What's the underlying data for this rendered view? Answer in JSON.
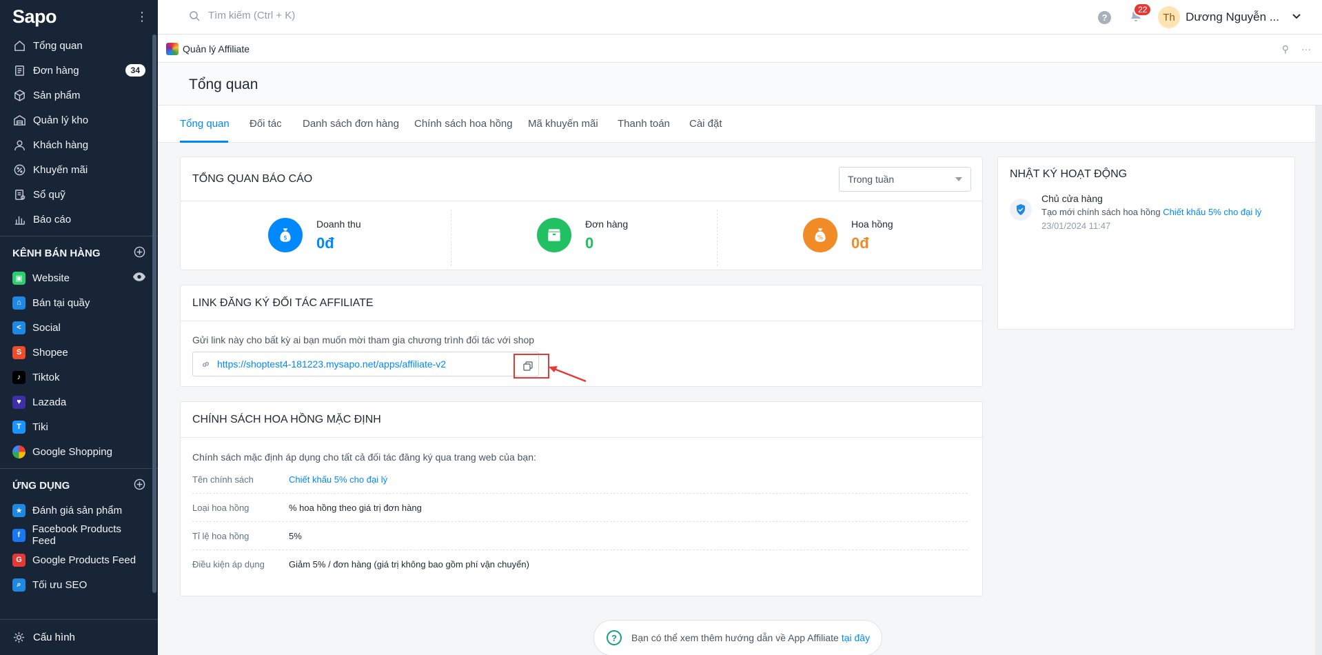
{
  "sidebar": {
    "logo": "Sapo",
    "main_items": [
      {
        "label": "Tổng quan",
        "icon": "home-icon"
      },
      {
        "label": "Đơn hàng",
        "icon": "order-icon",
        "badge": "34"
      },
      {
        "label": "Sản phẩm",
        "icon": "box-icon"
      },
      {
        "label": "Quản lý kho",
        "icon": "warehouse-icon"
      },
      {
        "label": "Khách hàng",
        "icon": "user-icon"
      },
      {
        "label": "Khuyến mãi",
        "icon": "discount-icon"
      },
      {
        "label": "Sổ quỹ",
        "icon": "ledger-icon"
      },
      {
        "label": "Báo cáo",
        "icon": "chart-icon"
      }
    ],
    "channels_title": "KÊNH BÁN HÀNG",
    "channels": [
      {
        "label": "Website",
        "color": "#2ecc71"
      },
      {
        "label": "Bán tại quầy",
        "color": "#1e88e5"
      },
      {
        "label": "Social",
        "color": "#1e88e5"
      },
      {
        "label": "Shopee",
        "color": "#ee4d2d"
      },
      {
        "label": "Tiktok",
        "color": "#000000"
      },
      {
        "label": "Lazada",
        "color": "#3d2fa8"
      },
      {
        "label": "Tiki",
        "color": "#1a94ff"
      },
      {
        "label": "Google Shopping",
        "color": "#ffffff"
      }
    ],
    "apps_title": "ỨNG DỤNG",
    "apps": [
      {
        "label": "Đánh giá sản phẩm",
        "color": "#1e88e5"
      },
      {
        "label": "Facebook Products Feed",
        "color": "#1877f2"
      },
      {
        "label": "Google Products Feed",
        "color": "#e53935"
      },
      {
        "label": "Tối ưu SEO",
        "color": "#1e88e5"
      }
    ],
    "settings_label": "Cấu hình"
  },
  "topbar": {
    "search_placeholder": "Tìm kiếm (Ctrl + K)",
    "notif_count": "22",
    "avatar_initials": "Th",
    "user_name": "Dương Nguyễn ..."
  },
  "app": {
    "name": "Quản lý Affiliate",
    "page_title": "Tổng quan",
    "tabs": [
      "Tổng quan",
      "Đối tác",
      "Danh sách đơn hàng",
      "Chính sách hoa hồng",
      "Mã khuyến mãi",
      "Thanh toán",
      "Cài đặt"
    ]
  },
  "report": {
    "title": "TỔNG QUAN BÁO CÁO",
    "period": "Trong tuần",
    "stats": [
      {
        "label": "Doanh thu",
        "value": "0đ",
        "color": "#0088ff"
      },
      {
        "label": "Đơn hàng",
        "value": "0",
        "color": "#20c063"
      },
      {
        "label": "Hoa hồng",
        "value": "0đ",
        "color": "#f08b26"
      }
    ]
  },
  "affiliate_link": {
    "title": "LINK ĐĂNG KÝ ĐỐI TÁC AFFILIATE",
    "description": "Gửi link này cho bất kỳ ai bạn muốn mời tham gia chương trình đối tác với shop",
    "url": "https://shoptest4-181223.mysapo.net/apps/affiliate-v2"
  },
  "policy": {
    "title": "CHÍNH SÁCH HOA HỒNG MẶC ĐỊNH",
    "description": "Chính sách mặc định áp dụng cho tất cả đối tác đăng ký qua trang web của bạn:",
    "rows": [
      {
        "key": "Tên chính sách",
        "value": "Chiết khấu 5% cho đại lý"
      },
      {
        "key": "Loại hoa hồng",
        "value": "% hoa hồng theo giá trị đơn hàng"
      },
      {
        "key": "Tỉ lệ hoa hồng",
        "value": "5%"
      },
      {
        "key": "Điều kiện áp dụng",
        "value": "Giảm 5% / đơn hàng (giá trị không bao gồm phí vận chuyển)"
      }
    ]
  },
  "activity": {
    "title": "NHẬT KÝ HOẠT ĐỘNG",
    "actor": "Chủ cửa hàng",
    "action": "Tạo mới chính sách hoa hồng",
    "target": "Chiết khấu 5% cho đại lý",
    "time": "23/01/2024 11:47"
  },
  "help": {
    "text": "Bạn có thể xem thêm hướng dẫn về App Affiliate",
    "link": "tại đây"
  }
}
